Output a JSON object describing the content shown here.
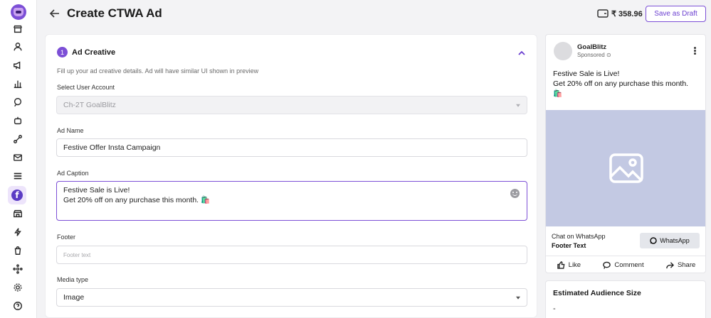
{
  "header": {
    "title": "Create CTWA Ad",
    "balance": "₹ 358.96",
    "save_draft_label": "Save as Draft"
  },
  "sidebar": {
    "items": [
      {
        "icon": "store-icon"
      },
      {
        "icon": "user-icon"
      },
      {
        "icon": "megaphone-icon"
      },
      {
        "icon": "bar-chart-icon"
      },
      {
        "icon": "chat-icon"
      },
      {
        "icon": "bot-icon"
      },
      {
        "icon": "integration-icon"
      },
      {
        "icon": "mail-icon"
      },
      {
        "icon": "list-icon"
      },
      {
        "icon": "facebook-icon",
        "active": true
      },
      {
        "icon": "shop-icon"
      },
      {
        "icon": "lightning-icon"
      },
      {
        "icon": "shopify-icon"
      },
      {
        "icon": "network-icon"
      },
      {
        "icon": "settings-icon"
      },
      {
        "icon": "help-icon"
      }
    ]
  },
  "form": {
    "step_number": "1",
    "step_title": "Ad Creative",
    "hint": "Fill up your ad creative details. Ad will have similar UI shown in preview",
    "user_account_label": "Select User Account",
    "user_account_value": "Ch-2T GoalBlitz",
    "ad_name_label": "Ad Name",
    "ad_name_value": "Festive Offer Insta Campaign",
    "ad_caption_label": "Ad Caption",
    "ad_caption_line1": "Festive Sale is Live!",
    "ad_caption_line2": "Get 20% off on any purchase this month. 🛍️",
    "footer_label": "Footer",
    "footer_placeholder": "Footer text",
    "media_type_label": "Media type",
    "media_type_value": "Image"
  },
  "preview": {
    "page_name": "GoalBlitz",
    "sponsored": "Sponsored",
    "caption_line1": "Festive Sale is Live!",
    "caption_line2": "Get 20% off on any purchase this month.",
    "caption_emoji": "🛍️",
    "cta_text": "Chat on WhatsApp",
    "footer_text": "Footer Text",
    "cta_button": "WhatsApp",
    "actions": {
      "like": "Like",
      "comment": "Comment",
      "share": "Share"
    }
  },
  "audience": {
    "title": "Estimated Audience Size",
    "value": "-"
  },
  "colors": {
    "accent": "#7c4fd6",
    "media_placeholder": "#c3c9e3"
  }
}
